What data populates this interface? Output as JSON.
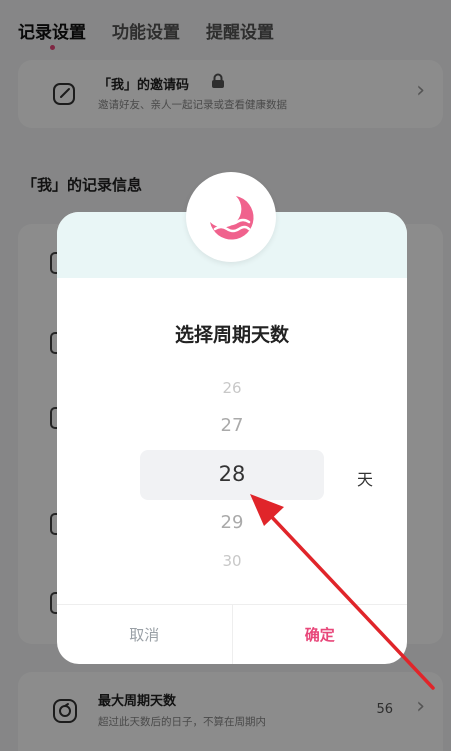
{
  "tabs": [
    {
      "label": "记录设置",
      "active": true
    },
    {
      "label": "功能设置",
      "active": false
    },
    {
      "label": "提醒设置",
      "active": false
    }
  ],
  "invite": {
    "title": "「我」的邀请码",
    "subtitle": "邀请好友、亲人一起记录或查看健康数据",
    "icon": "edit-icon",
    "locked_icon": "lock-icon"
  },
  "section": {
    "title": "「我」的记录信息"
  },
  "max_cycle": {
    "title": "最大周期天数",
    "subtitle": "超过此天数后的日子，不算在周期内",
    "value": "56",
    "icon": "cycle-icon"
  },
  "dialog": {
    "title": "选择周期天数",
    "unit": "天",
    "options": [
      "26",
      "27",
      "28",
      "29",
      "30"
    ],
    "selected": "28",
    "cancel_label": "取消",
    "confirm_label": "确定",
    "badge_icon": "moon-icon"
  },
  "colors": {
    "accent": "#e8477a",
    "dialog_header": "#e9f6f6",
    "annotation_arrow": "#e0252a"
  }
}
